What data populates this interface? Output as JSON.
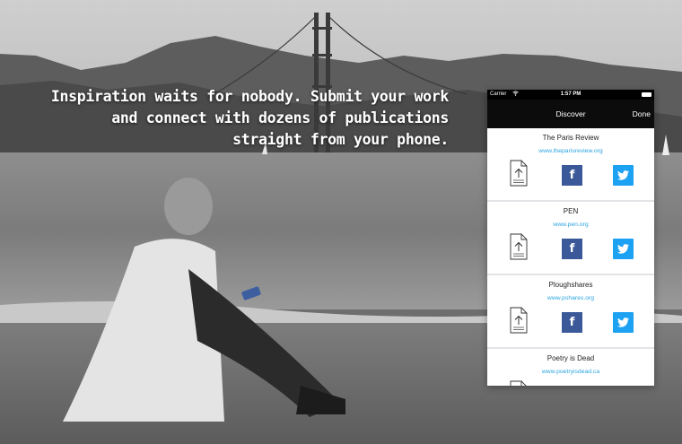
{
  "tagline": {
    "line1": "Inspiration waits for nobody. Submit your work",
    "line2": "and connect with dozens of publications",
    "line3": "straight from your phone."
  },
  "phone": {
    "status": {
      "carrier": "Carrier",
      "time": "1:57 PM",
      "wifi_icon": "wifi-icon",
      "battery_icon": "battery-icon"
    },
    "nav": {
      "title": "Discover",
      "done_label": "Done"
    },
    "publications": [
      {
        "name": "The Paris Review",
        "url": "www.theparisreview.org"
      },
      {
        "name": "PEN",
        "url": "www.pen.org"
      },
      {
        "name": "Ploughshares",
        "url": "www.pshares.org"
      },
      {
        "name": "Poetry is Dead",
        "url": "www.poetryisdead.ca"
      }
    ],
    "icons": {
      "upload": "upload-document-icon",
      "facebook": "facebook-icon",
      "twitter": "twitter-icon"
    },
    "colors": {
      "facebook": "#3b5998",
      "twitter": "#1da1f2",
      "link": "#2aa4e0",
      "nav": "#0c0c0c"
    }
  }
}
